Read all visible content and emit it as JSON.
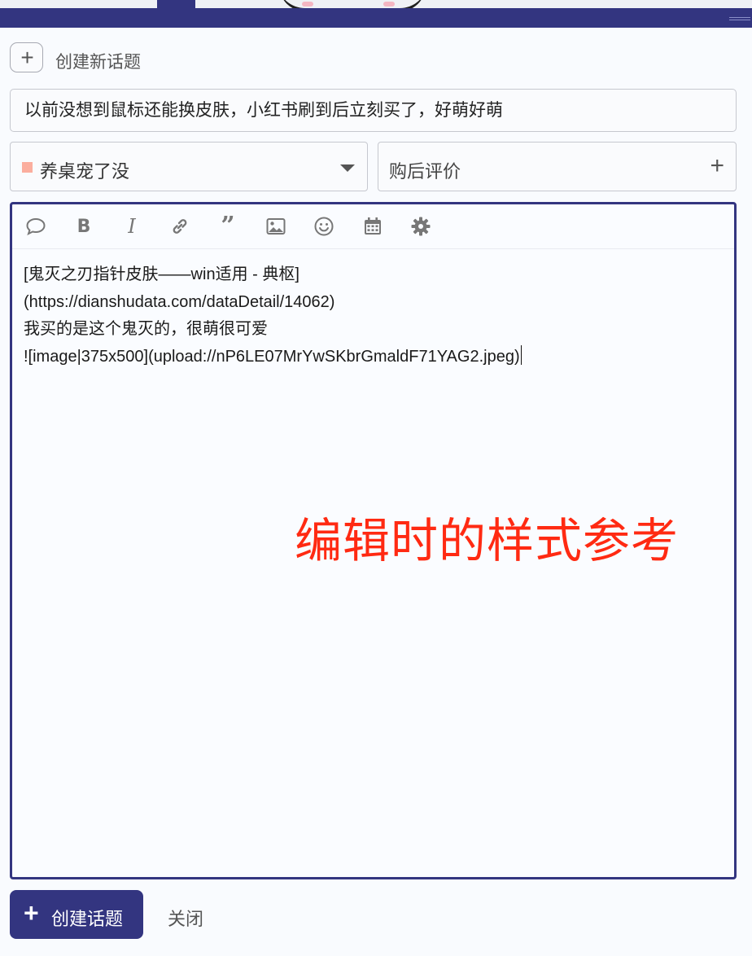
{
  "composer": {
    "new_topic_label": "创建新话题",
    "title_value": "以前没想到鼠标还能换皮肤，小红书刷到后立刻买了，好萌好萌",
    "category": {
      "label": "养桌宠了没",
      "color": "#fbae9e"
    },
    "tag": {
      "label": "购后评价"
    },
    "toolbar_icons": [
      "speech-bubble-icon",
      "bold-icon",
      "italic-icon",
      "link-icon",
      "quote-icon",
      "image-icon",
      "emoji-icon",
      "calendar-icon",
      "gear-icon"
    ],
    "editor_lines": [
      "[鬼灭之刃指针皮肤——win适用 - 典枢]",
      "(https://dianshudata.com/dataDetail/14062)",
      "我买的是这个鬼灭的，很萌很可爱",
      "![image|375x500](upload://nP6LE07MrYwSKbrGmaldF71YAG2.jpeg)"
    ],
    "watermark": "编辑时的样式参考",
    "submit_label": "创建话题",
    "close_label": "关闭"
  },
  "colors": {
    "brand": "#333580",
    "watermark": "#ff2a12",
    "background": "#f9fbfe"
  }
}
